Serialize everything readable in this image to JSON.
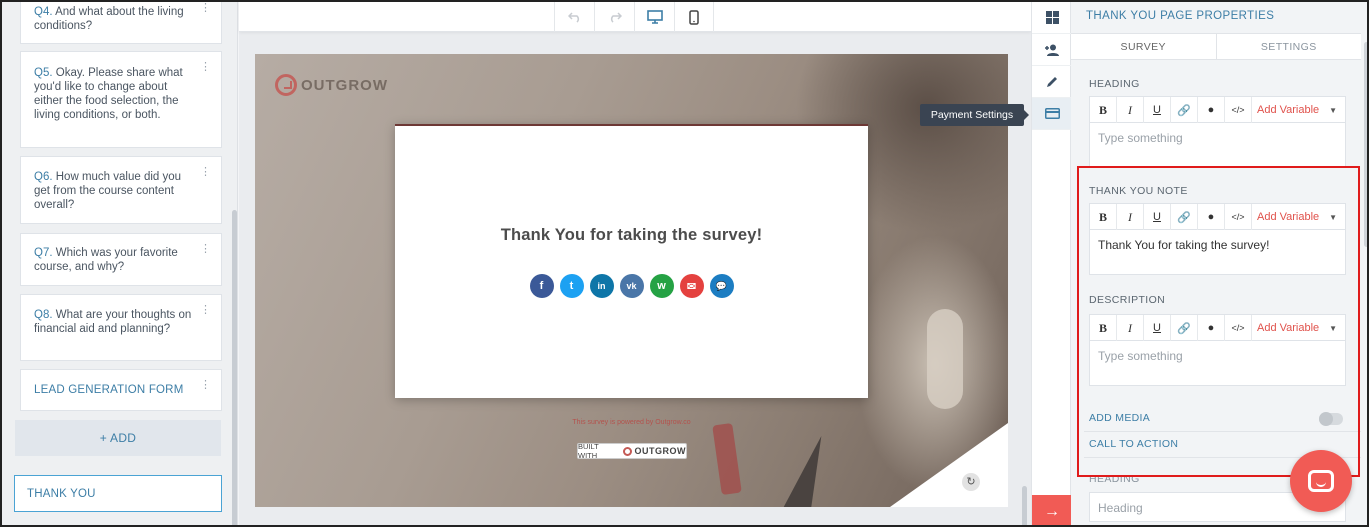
{
  "sidebar": {
    "questions": [
      {
        "num": "Q4.",
        "text": "And what about the living conditions?"
      },
      {
        "num": "Q5.",
        "text": "Okay. Please share what you'd like to change about either the food selection, the living conditions, or both."
      },
      {
        "num": "Q6.",
        "text": "How much value did you get from the course content overall?"
      },
      {
        "num": "Q7.",
        "text": "Which was your favorite course, and why?"
      },
      {
        "num": "Q8.",
        "text": "What are your thoughts on financial aid and planning?"
      }
    ],
    "lead_form": "LEAD GENERATION FORM",
    "add_label": "ADD",
    "add_icon": "+",
    "thank_you": "THANK YOU"
  },
  "toolbar": {
    "undo_icon": "undo-icon",
    "redo_icon": "redo-icon",
    "desktop_icon": "desktop-icon",
    "mobile_icon": "mobile-icon"
  },
  "preview": {
    "logo_text": "OUTGROW",
    "message": "Thank You for taking the survey!",
    "share_buttons": [
      {
        "name": "facebook",
        "glyph": "f",
        "color": "#3b5998"
      },
      {
        "name": "twitter",
        "glyph": "t",
        "color": "#1da1f2"
      },
      {
        "name": "linkedin",
        "glyph": "in",
        "color": "#0e76a8"
      },
      {
        "name": "vk",
        "glyph": "vk",
        "color": "#4a76a8"
      },
      {
        "name": "whatsapp",
        "glyph": "w",
        "color": "#25a244"
      },
      {
        "name": "email",
        "glyph": "✉",
        "color": "#e4413f"
      },
      {
        "name": "messenger",
        "glyph": "💬",
        "color": "#1c7dc2"
      }
    ],
    "powered_by": "This survey is powered by Outgrow.co",
    "built_with": "BUILT WITH",
    "built_brand": "OUTGROW"
  },
  "icon_strip": {
    "tooltip": "Payment Settings",
    "icons": [
      "dashboard-icon",
      "add-user-icon",
      "pencil-icon",
      "credit-card-icon"
    ],
    "next_icon": "→"
  },
  "panel": {
    "title": "THANK YOU PAGE PROPERTIES",
    "tabs": [
      "SURVEY",
      "SETTINGS"
    ],
    "heading_label": "HEADING",
    "heading_placeholder": "Type something",
    "note_label": "THANK YOU NOTE",
    "note_value": "Thank You for taking the survey!",
    "description_label": "DESCRIPTION",
    "description_placeholder": "Type something",
    "toolbar": {
      "bold": "B",
      "italic": "I",
      "underline": "U",
      "link": "🔗",
      "color": "💧",
      "code": "</>",
      "add_variable": "Add Variable"
    },
    "add_media": "ADD MEDIA",
    "call_to_action": "CALL TO ACTION",
    "cta_heading_label": "HEADING",
    "cta_heading_placeholder": "Heading"
  },
  "colors": {
    "accent": "#3d7ea6",
    "brand_red": "#f15b55",
    "highlight": "#e01b1b"
  }
}
